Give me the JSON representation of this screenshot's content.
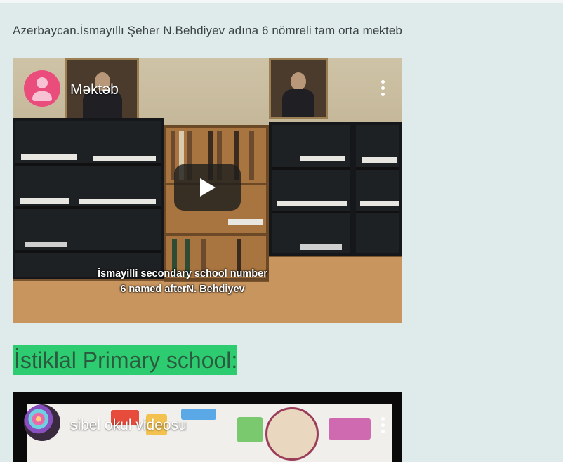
{
  "page": {
    "caption": "Azerbaycan.İsmayıllı Şeher N.Behdiyev adına 6 nömreli tam orta mekteb",
    "section_heading": "İstiklal Primary school:"
  },
  "videos": [
    {
      "channel_name": "Məktəb",
      "subtitle_line1": "İsmayilli secondary school number",
      "subtitle_line2": "6  named afterN. Behdiyev",
      "thumbnail_subject": "classroom-bookshelves"
    },
    {
      "channel_name": "sibel okul videosu",
      "thumbnail_subject": "decorated-classroom-wall"
    }
  ],
  "colors": {
    "page_background": "#dfeaea",
    "heading_highlight": "#2ecc71",
    "heading_text": "#2b5a3f",
    "channel_avatar": "#ea4d7c"
  },
  "icons": [
    "user-avatar-icon",
    "kebab-menu-icon",
    "play-icon"
  ]
}
